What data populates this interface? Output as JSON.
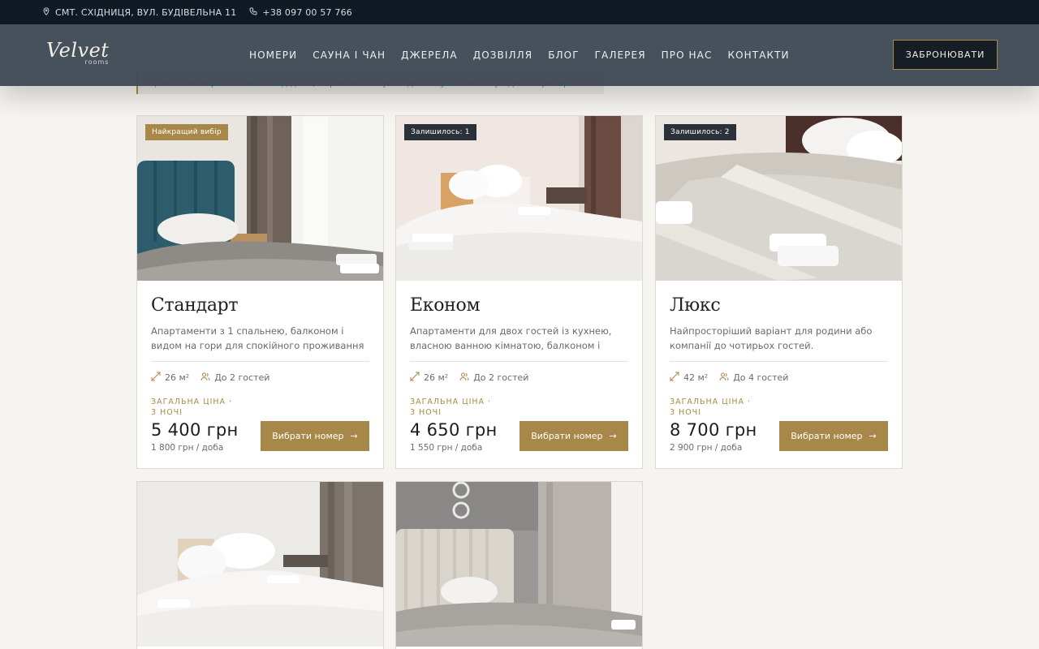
{
  "topbar": {
    "address": "СМТ. СХІДНИЦЯ, ВУЛ. БУДІВЕЛЬНА 11",
    "phone": "+38 097 00 57 766"
  },
  "header": {
    "logo_main": "Velvet",
    "logo_sub": "rooms",
    "nav": [
      "НОМЕРИ",
      "САУНА І ЧАН",
      "ДЖЕРЕЛА",
      "ДОЗВІЛЛЯ",
      "БЛОГ",
      "ГАЛЕРЕЯ",
      "ПРО НАС",
      "КОНТАКТИ"
    ],
    "book_label": "ЗАБРОНЮВАТИ"
  },
  "notice": "Ціни на номери залежать від дати, обраних послуг — деталі уточнюйте у адміністратора",
  "rooms": [
    {
      "badge": "Найкращий вибір",
      "title": "Стандарт",
      "desc": "Апартаменти з 1 спальнею, балконом і видом на гори для спокійного проживання двох гостей.",
      "area": "26 м²",
      "guests": "До 2 гостей",
      "price_label": "ЗАГАЛЬНА ЦІНА · 3 НОЧІ",
      "price": "5 400 грн",
      "per_night": "1 800 грн / доба",
      "button": "Вибрати номер"
    },
    {
      "badge": "Залишилось: 1",
      "title": "Економ",
      "desc": "Апартаменти для двох гостей із кухнею, власною ванною кімнатою, балконом і видами…",
      "area": "26 м²",
      "guests": "До 2 гостей",
      "price_label": "ЗАГАЛЬНА ЦІНА · 3 НОЧІ",
      "price": "4 650 грн",
      "per_night": "1 550 грн / доба",
      "button": "Вибрати номер"
    },
    {
      "badge": "Залишилось: 2",
      "title": "Люкс",
      "desc": "Найпросторіший варіант для родини або компанії до чотирьох гостей.",
      "area": "42 м²",
      "guests": "До 4 гостей",
      "price_label": "ЗАГАЛЬНА ЦІНА · 3 НОЧІ",
      "price": "8 700 грн",
      "per_night": "2 900 грн / доба",
      "button": "Вибрати номер"
    }
  ],
  "colors": {
    "accent": "#a88848",
    "topbar": "#0f1a24",
    "header": "#404a54",
    "background": "#f6f4f0"
  }
}
